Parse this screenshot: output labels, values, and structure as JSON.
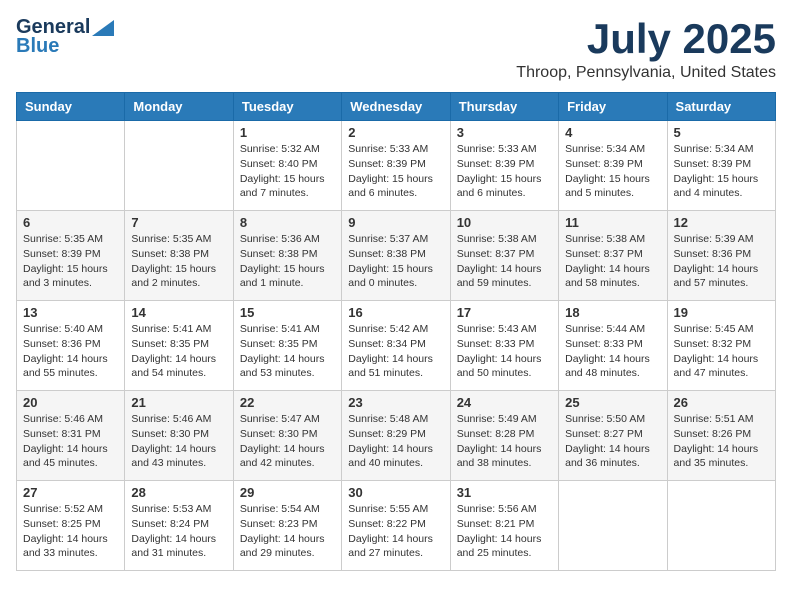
{
  "logo": {
    "line1": "General",
    "line2": "Blue"
  },
  "title": "July 2025",
  "location": "Throop, Pennsylvania, United States",
  "weekdays": [
    "Sunday",
    "Monday",
    "Tuesday",
    "Wednesday",
    "Thursday",
    "Friday",
    "Saturday"
  ],
  "weeks": [
    [
      {
        "day": "",
        "info": ""
      },
      {
        "day": "",
        "info": ""
      },
      {
        "day": "1",
        "info": "Sunrise: 5:32 AM\nSunset: 8:40 PM\nDaylight: 15 hours\nand 7 minutes."
      },
      {
        "day": "2",
        "info": "Sunrise: 5:33 AM\nSunset: 8:39 PM\nDaylight: 15 hours\nand 6 minutes."
      },
      {
        "day": "3",
        "info": "Sunrise: 5:33 AM\nSunset: 8:39 PM\nDaylight: 15 hours\nand 6 minutes."
      },
      {
        "day": "4",
        "info": "Sunrise: 5:34 AM\nSunset: 8:39 PM\nDaylight: 15 hours\nand 5 minutes."
      },
      {
        "day": "5",
        "info": "Sunrise: 5:34 AM\nSunset: 8:39 PM\nDaylight: 15 hours\nand 4 minutes."
      }
    ],
    [
      {
        "day": "6",
        "info": "Sunrise: 5:35 AM\nSunset: 8:39 PM\nDaylight: 15 hours\nand 3 minutes."
      },
      {
        "day": "7",
        "info": "Sunrise: 5:35 AM\nSunset: 8:38 PM\nDaylight: 15 hours\nand 2 minutes."
      },
      {
        "day": "8",
        "info": "Sunrise: 5:36 AM\nSunset: 8:38 PM\nDaylight: 15 hours\nand 1 minute."
      },
      {
        "day": "9",
        "info": "Sunrise: 5:37 AM\nSunset: 8:38 PM\nDaylight: 15 hours\nand 0 minutes."
      },
      {
        "day": "10",
        "info": "Sunrise: 5:38 AM\nSunset: 8:37 PM\nDaylight: 14 hours\nand 59 minutes."
      },
      {
        "day": "11",
        "info": "Sunrise: 5:38 AM\nSunset: 8:37 PM\nDaylight: 14 hours\nand 58 minutes."
      },
      {
        "day": "12",
        "info": "Sunrise: 5:39 AM\nSunset: 8:36 PM\nDaylight: 14 hours\nand 57 minutes."
      }
    ],
    [
      {
        "day": "13",
        "info": "Sunrise: 5:40 AM\nSunset: 8:36 PM\nDaylight: 14 hours\nand 55 minutes."
      },
      {
        "day": "14",
        "info": "Sunrise: 5:41 AM\nSunset: 8:35 PM\nDaylight: 14 hours\nand 54 minutes."
      },
      {
        "day": "15",
        "info": "Sunrise: 5:41 AM\nSunset: 8:35 PM\nDaylight: 14 hours\nand 53 minutes."
      },
      {
        "day": "16",
        "info": "Sunrise: 5:42 AM\nSunset: 8:34 PM\nDaylight: 14 hours\nand 51 minutes."
      },
      {
        "day": "17",
        "info": "Sunrise: 5:43 AM\nSunset: 8:33 PM\nDaylight: 14 hours\nand 50 minutes."
      },
      {
        "day": "18",
        "info": "Sunrise: 5:44 AM\nSunset: 8:33 PM\nDaylight: 14 hours\nand 48 minutes."
      },
      {
        "day": "19",
        "info": "Sunrise: 5:45 AM\nSunset: 8:32 PM\nDaylight: 14 hours\nand 47 minutes."
      }
    ],
    [
      {
        "day": "20",
        "info": "Sunrise: 5:46 AM\nSunset: 8:31 PM\nDaylight: 14 hours\nand 45 minutes."
      },
      {
        "day": "21",
        "info": "Sunrise: 5:46 AM\nSunset: 8:30 PM\nDaylight: 14 hours\nand 43 minutes."
      },
      {
        "day": "22",
        "info": "Sunrise: 5:47 AM\nSunset: 8:30 PM\nDaylight: 14 hours\nand 42 minutes."
      },
      {
        "day": "23",
        "info": "Sunrise: 5:48 AM\nSunset: 8:29 PM\nDaylight: 14 hours\nand 40 minutes."
      },
      {
        "day": "24",
        "info": "Sunrise: 5:49 AM\nSunset: 8:28 PM\nDaylight: 14 hours\nand 38 minutes."
      },
      {
        "day": "25",
        "info": "Sunrise: 5:50 AM\nSunset: 8:27 PM\nDaylight: 14 hours\nand 36 minutes."
      },
      {
        "day": "26",
        "info": "Sunrise: 5:51 AM\nSunset: 8:26 PM\nDaylight: 14 hours\nand 35 minutes."
      }
    ],
    [
      {
        "day": "27",
        "info": "Sunrise: 5:52 AM\nSunset: 8:25 PM\nDaylight: 14 hours\nand 33 minutes."
      },
      {
        "day": "28",
        "info": "Sunrise: 5:53 AM\nSunset: 8:24 PM\nDaylight: 14 hours\nand 31 minutes."
      },
      {
        "day": "29",
        "info": "Sunrise: 5:54 AM\nSunset: 8:23 PM\nDaylight: 14 hours\nand 29 minutes."
      },
      {
        "day": "30",
        "info": "Sunrise: 5:55 AM\nSunset: 8:22 PM\nDaylight: 14 hours\nand 27 minutes."
      },
      {
        "day": "31",
        "info": "Sunrise: 5:56 AM\nSunset: 8:21 PM\nDaylight: 14 hours\nand 25 minutes."
      },
      {
        "day": "",
        "info": ""
      },
      {
        "day": "",
        "info": ""
      }
    ]
  ]
}
